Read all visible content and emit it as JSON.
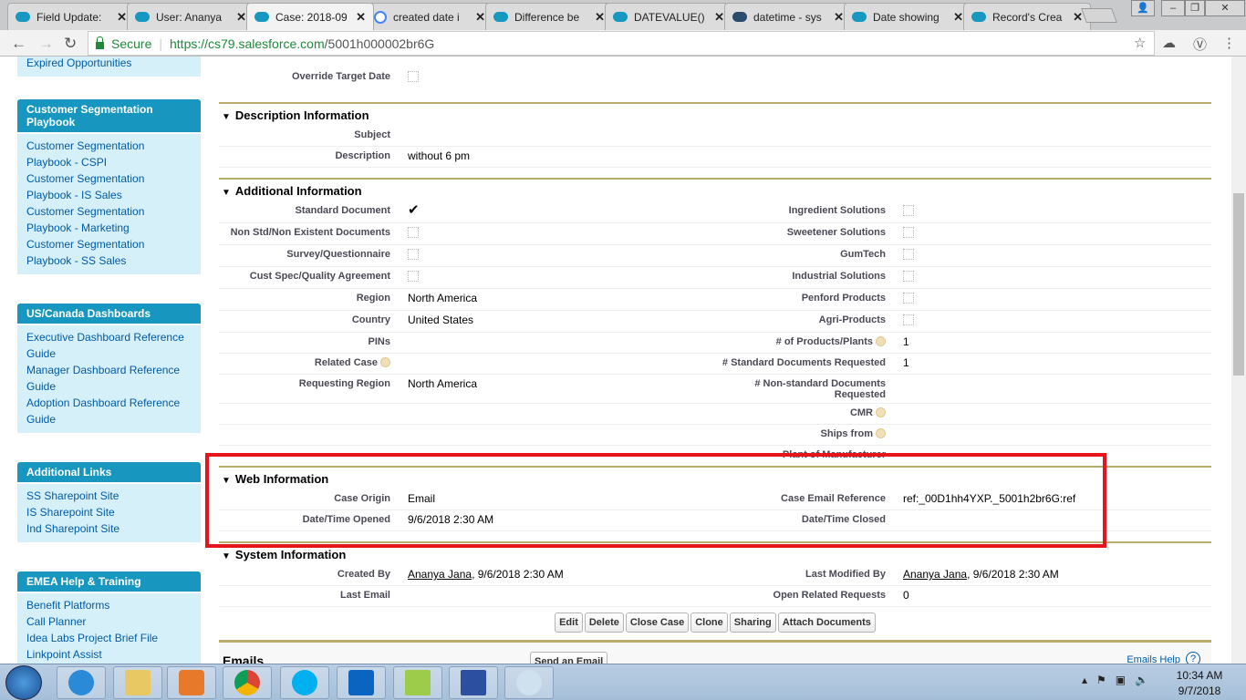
{
  "browser": {
    "tabs": [
      {
        "title": "Field Update:",
        "icon": "salesforce"
      },
      {
        "title": "User: Ananya",
        "icon": "salesforce"
      },
      {
        "title": "Case: 2018-09",
        "icon": "salesforce",
        "active": true
      },
      {
        "title": "created date i",
        "icon": "google"
      },
      {
        "title": "Difference be",
        "icon": "salesforce"
      },
      {
        "title": "DATEVALUE()",
        "icon": "salesforce"
      },
      {
        "title": "datetime - sys",
        "icon": "stackexchange"
      },
      {
        "title": "Date showing",
        "icon": "salesforce"
      },
      {
        "title": "Record's Crea",
        "icon": "salesforce"
      }
    ],
    "secure_label": "Secure",
    "url_host": "https://cs79.salesforce.com",
    "url_path": "/5001h000002br6G"
  },
  "sidebar": [
    {
      "title": "",
      "links": [
        "Expired Opportunities"
      ]
    },
    {
      "title": "Customer Segmentation Playbook",
      "links": [
        "Customer Segmentation Playbook - CSPI",
        "Customer Segmentation Playbook - IS Sales",
        "Customer Segmentation Playbook - Marketing",
        "Customer Segmentation Playbook - SS Sales"
      ]
    },
    {
      "title": "US/Canada Dashboards",
      "links": [
        "Executive Dashboard Reference Guide",
        "Manager Dashboard Reference Guide",
        "Adoption Dashboard Reference Guide"
      ]
    },
    {
      "title": "Additional Links",
      "links": [
        "SS Sharepoint Site",
        "IS Sharepoint Site",
        "Ind Sharepoint Site"
      ]
    },
    {
      "title": "EMEA Help & Training",
      "links": [
        "Benefit Platforms",
        "Call Planner",
        "Idea Labs Project Brief File",
        "Linkpoint Assist"
      ]
    }
  ],
  "top_rows": [
    {
      "l": {
        "label": "Override Target Date",
        "type": "checkbox",
        "checked": false
      },
      "r": null
    }
  ],
  "sections": [
    {
      "title": "Description Information",
      "rows": [
        {
          "l": {
            "label": "Subject",
            "value": ""
          },
          "r": null
        },
        {
          "l": {
            "label": "Description",
            "value": "without 6 pm"
          },
          "r": null
        }
      ]
    },
    {
      "title": "Additional Information",
      "rows": [
        {
          "l": {
            "label": "Standard Document",
            "type": "checkbox",
            "checked": true
          },
          "r": {
            "label": "Ingredient Solutions",
            "type": "checkbox",
            "checked": false
          }
        },
        {
          "l": {
            "label": "Non Std/Non Existent Documents",
            "type": "checkbox",
            "checked": false
          },
          "r": {
            "label": "Sweetener Solutions",
            "type": "checkbox",
            "checked": false
          }
        },
        {
          "l": {
            "label": "Survey/Questionnaire",
            "type": "checkbox",
            "checked": false
          },
          "r": {
            "label": "GumTech",
            "type": "checkbox",
            "checked": false
          }
        },
        {
          "l": {
            "label": "Cust Spec/Quality Agreement",
            "type": "checkbox",
            "checked": false
          },
          "r": {
            "label": "Industrial Solutions",
            "type": "checkbox",
            "checked": false
          }
        },
        {
          "l": {
            "label": "Region",
            "value": "North America"
          },
          "r": {
            "label": "Penford Products",
            "type": "checkbox",
            "checked": false
          }
        },
        {
          "l": {
            "label": "Country",
            "value": "United States"
          },
          "r": {
            "label": "Agri-Products",
            "type": "checkbox",
            "checked": false
          }
        },
        {
          "l": {
            "label": "PINs",
            "value": ""
          },
          "r": {
            "label": "# of Products/Plants",
            "info": true,
            "value": "1"
          }
        },
        {
          "l": {
            "label": "Related Case",
            "info": true,
            "value": ""
          },
          "r": {
            "label": "# Standard Documents Requested",
            "value": "1"
          }
        },
        {
          "l": {
            "label": "Requesting Region",
            "value": "North America"
          },
          "r": {
            "label": "# Non-standard Documents Requested",
            "value": ""
          }
        },
        {
          "l": null,
          "r": {
            "label": "CMR",
            "info": true,
            "value": ""
          }
        },
        {
          "l": null,
          "r": {
            "label": "Ships from",
            "info": true,
            "value": ""
          }
        },
        {
          "l": null,
          "r": {
            "label": "Plant of Manufacturer",
            "value": ""
          }
        }
      ]
    },
    {
      "title": "Web Information",
      "rows": [
        {
          "l": {
            "label": "Case Origin",
            "value": "Email"
          },
          "r": {
            "label": "Case Email Reference",
            "value": "ref:_00D1hh4YXP._5001h2br6G:ref"
          }
        },
        {
          "l": {
            "label": "Date/Time Opened",
            "value": "9/6/2018 2:30 AM"
          },
          "r": {
            "label": "Date/Time Closed",
            "value": ""
          }
        }
      ]
    },
    {
      "title": "System Information",
      "rows": [
        {
          "l": {
            "label": "Created By",
            "type": "link",
            "link": "Ananya Jana",
            "value": ", 9/6/2018 2:30 AM"
          },
          "r": {
            "label": "Last Modified By",
            "type": "link",
            "link": "Ananya Jana",
            "value": ", 9/6/2018 2:30 AM"
          }
        },
        {
          "l": {
            "label": "Last Email",
            "value": ""
          },
          "r": {
            "label": "Open Related Requests",
            "value": "0"
          }
        }
      ]
    }
  ],
  "buttons": [
    "Edit",
    "Delete",
    "Close Case",
    "Clone",
    "Sharing",
    "Attach Documents"
  ],
  "emails": {
    "title": "Emails",
    "send_label": "Send an Email",
    "help_label": "Emails Help",
    "help_icon": "?"
  },
  "taskbar": {
    "time": "10:34 AM",
    "date": "9/7/2018"
  }
}
